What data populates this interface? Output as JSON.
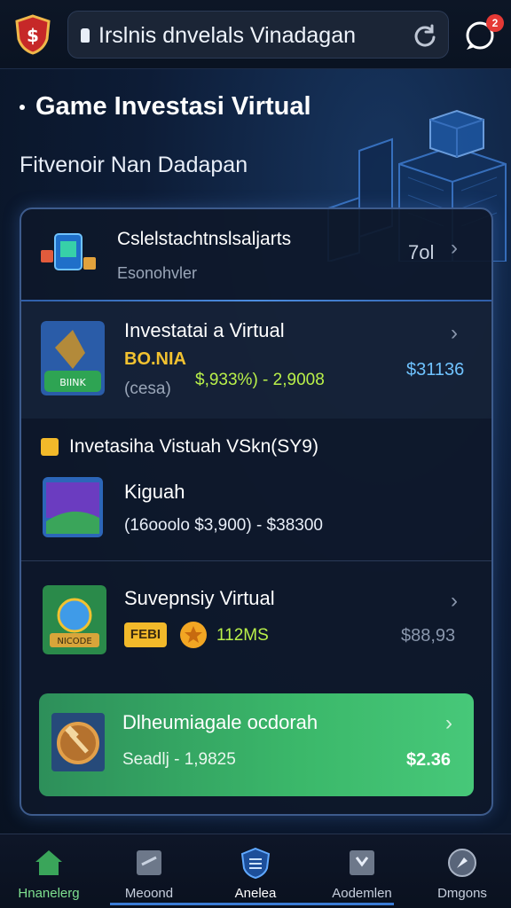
{
  "header": {
    "url_text": "Irslnis dnvelals Vinadagan",
    "notification_count": "2"
  },
  "page": {
    "title": "Game Investasi Virtual",
    "subtitle": "Fitvenoir Nan Dadapan"
  },
  "panel": {
    "top_item": {
      "title": "Cslelstachtnslsaljarts",
      "subtitle": "Esonohvler",
      "value": "7ol"
    },
    "item1": {
      "title": "Investatai a Virtual",
      "tag": "BO.NIA",
      "range": "$,933%) - 2,9008",
      "note": "(cesa)",
      "price": "$31136",
      "thumb_label": "BIINK"
    },
    "section": {
      "title": "Invetasiha Vistuah VSkn(SY9)"
    },
    "item2": {
      "title": "Kiguah",
      "range": "(16ooolo  $3,900) - $38300"
    },
    "item3": {
      "title": "Suvepnsiy Virtual",
      "badge": "FEBI",
      "value": "112MS",
      "price": "$88,93",
      "thumb_label": "NICODE"
    },
    "item4": {
      "title": "Dlheumiagale ocdorah",
      "sub": "Seadlj - 1,9825",
      "price": "$2.36"
    }
  },
  "nav": [
    {
      "label": "Hnanelerg"
    },
    {
      "label": "Meoond"
    },
    {
      "label": "Anelea"
    },
    {
      "label": "Aodemlen"
    },
    {
      "label": "Dmgons"
    }
  ],
  "colors": {
    "accent_blue": "#3a7bd5",
    "green_price": "#b9f04a",
    "blue_price": "#6fc3ff",
    "card_green": "#3bb86a"
  }
}
